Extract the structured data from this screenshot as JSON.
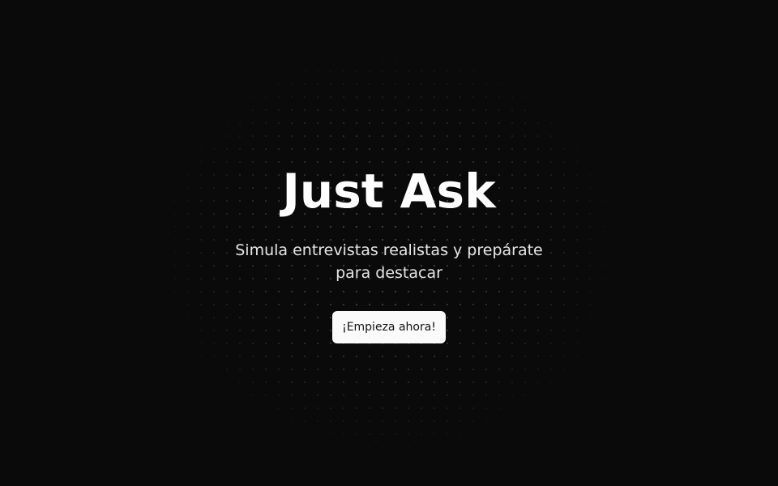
{
  "hero": {
    "title": "Just Ask",
    "subtitle": "Simula entrevistas realistas y prepárate para destacar",
    "cta_label": "¡Empieza ahora!"
  },
  "colors": {
    "background": "#0a0a0b",
    "text": "#ffffff",
    "button_bg": "#fafafa",
    "button_text": "#111111"
  }
}
